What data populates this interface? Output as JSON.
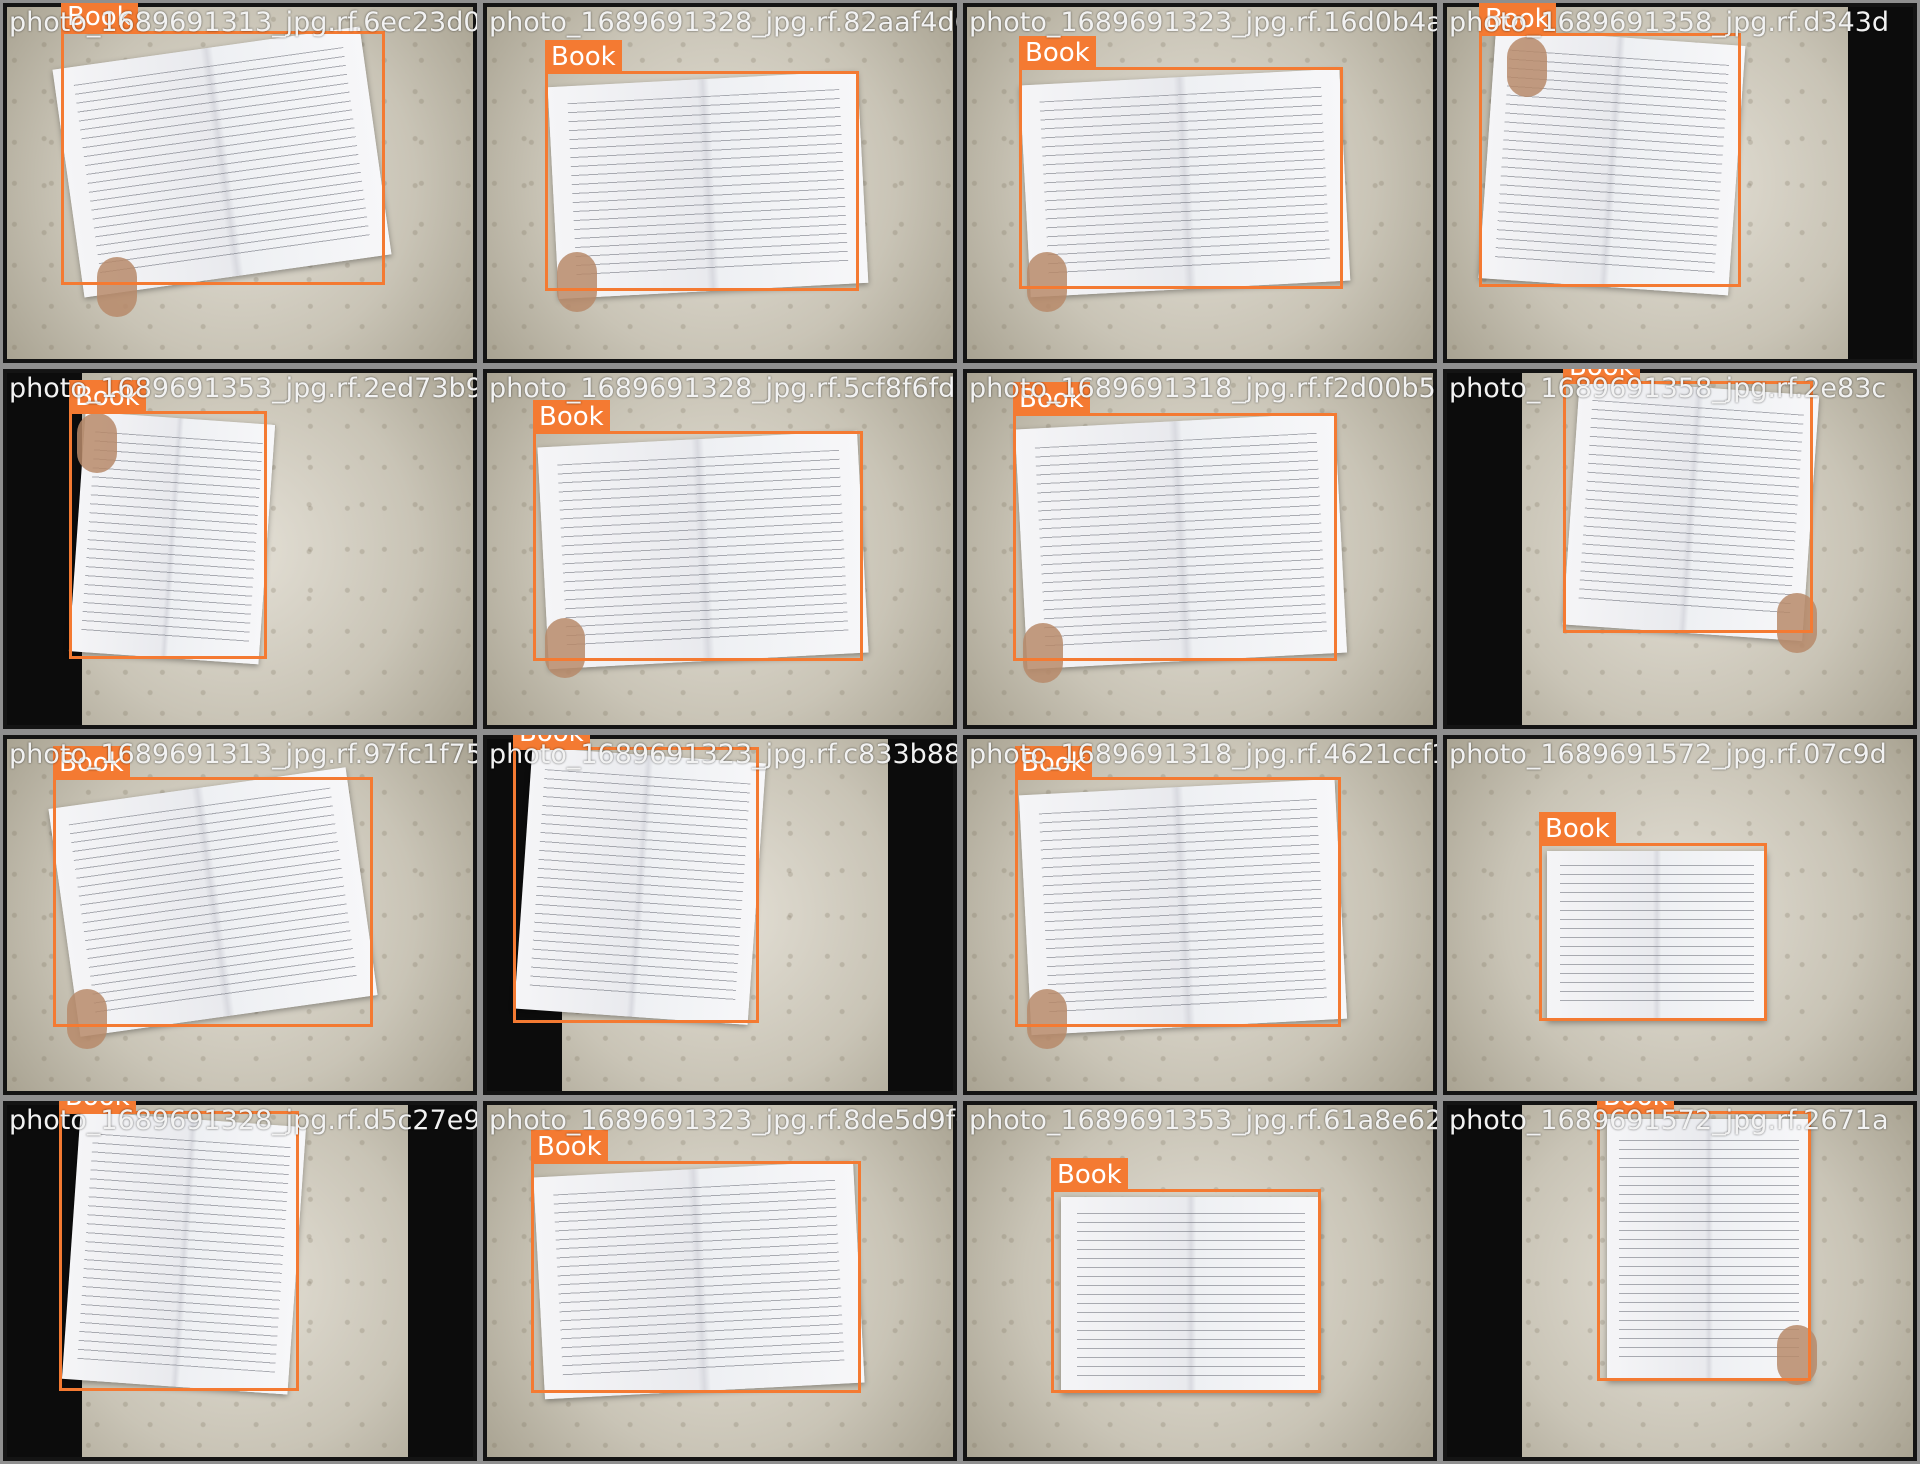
{
  "tiles": [
    {
      "filename": "photo_1689691313_jpg.rf.6ec23d055e4622",
      "label": "Book"
    },
    {
      "filename": "photo_1689691328_jpg.rf.82aaf4d6b01d0e",
      "label": "Book"
    },
    {
      "filename": "photo_1689691323_jpg.rf.16d0b4a3",
      "label": "Book"
    },
    {
      "filename": "photo_1689691358_jpg.rf.d343d",
      "label": "Book"
    },
    {
      "filename": "photo_1689691353_jpg.rf.2ed73b94bd15",
      "label": "Book"
    },
    {
      "filename": "photo_1689691328_jpg.rf.5cf8f6fd97",
      "label": "Book"
    },
    {
      "filename": "photo_1689691318_jpg.rf.f2d00b5cba8d2",
      "label": "Book"
    },
    {
      "filename": "photo_1689691358_jpg.rf.2e83c",
      "label": "Book"
    },
    {
      "filename": "photo_1689691313_jpg.rf.97fc1f75",
      "label": "Book"
    },
    {
      "filename": "photo_1689691323_jpg.rf.c833b8810",
      "label": "Book"
    },
    {
      "filename": "photo_1689691318_jpg.rf.4621ccf16",
      "label": "Book"
    },
    {
      "filename": "photo_1689691572_jpg.rf.07c9d",
      "label": "Book"
    },
    {
      "filename": "photo_1689691328_jpg.rf.d5c27e98473",
      "label": "Book"
    },
    {
      "filename": "photo_1689691323_jpg.rf.8de5d9f0f5f",
      "label": "Book"
    },
    {
      "filename": "photo_1689691353_jpg.rf.61a8e62794",
      "label": "Book"
    },
    {
      "filename": "photo_1689691572_jpg.rf.2671a",
      "label": "Book"
    }
  ],
  "colors": {
    "bbox": "#f47a32",
    "label_text": "#ffffff",
    "filename_text": "#f2f2f2",
    "background": "#8a8a8a"
  }
}
